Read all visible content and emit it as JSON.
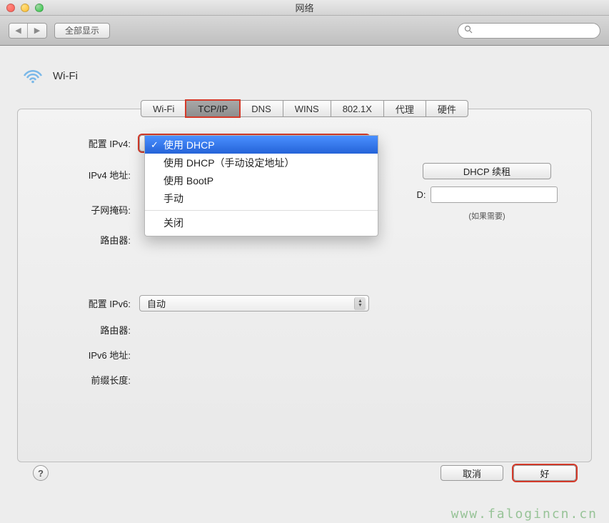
{
  "window": {
    "title": "网络"
  },
  "toolbar": {
    "show_all": "全部显示",
    "search_placeholder": ""
  },
  "header": {
    "service_name": "Wi-Fi"
  },
  "tabs": [
    {
      "label": "Wi-Fi",
      "active": false
    },
    {
      "label": "TCP/IP",
      "active": true
    },
    {
      "label": "DNS",
      "active": false
    },
    {
      "label": "WINS",
      "active": false
    },
    {
      "label": "802.1X",
      "active": false
    },
    {
      "label": "代理",
      "active": false
    },
    {
      "label": "硬件",
      "active": false
    }
  ],
  "ipv4": {
    "config_label": "配置 IPv4:",
    "selected": "使用 DHCP",
    "options": [
      "使用 DHCP",
      "使用 DHCP（手动设定地址）",
      "使用 BootP",
      "手动"
    ],
    "close_option": "关闭",
    "addr_label": "IPv4 地址:",
    "subnet_label": "子网掩码:",
    "router_label": "路由器:",
    "dhcp_renew": "DHCP 续租",
    "client_id_label": "D:",
    "client_id_hint": "(如果需要)"
  },
  "ipv6": {
    "config_label": "配置 IPv6:",
    "selected": "自动",
    "router_label": "路由器:",
    "addr_label": "IPv6 地址:",
    "prefix_label": "前缀长度:"
  },
  "buttons": {
    "cancel": "取消",
    "ok": "好"
  },
  "watermark": "www.falogincn.cn"
}
